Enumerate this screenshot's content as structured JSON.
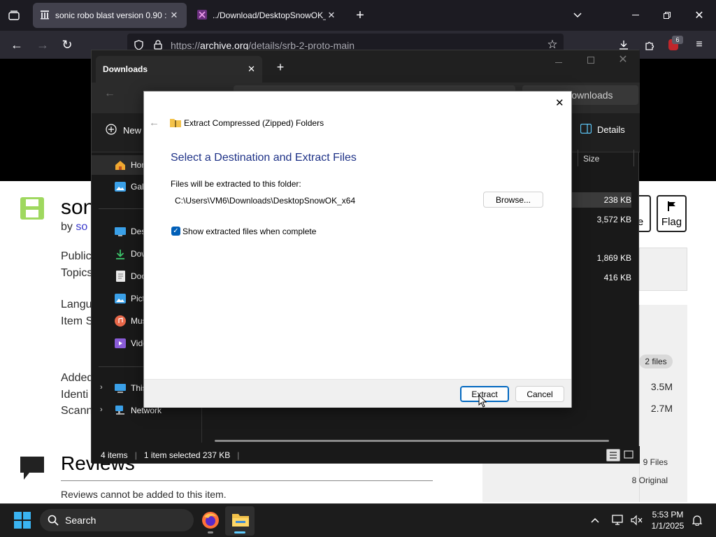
{
  "browser": {
    "tabs": [
      {
        "label": "sonic robo blast version 0.90 : s"
      },
      {
        "label": "../Download/DesktopSnowOK_"
      }
    ],
    "url_prefix": "https://",
    "url_domain": "archive.org",
    "url_path": "/details/srb-2-proto-main",
    "extensions_badge": "6"
  },
  "page": {
    "title_fragment": "son",
    "by_label": "by",
    "by_link": "so",
    "meta_lines": [
      "Public",
      "Topics",
      "Langu",
      "Item S",
      "Added",
      "Identi",
      "Scann"
    ],
    "share_label": "re",
    "flag_label": "Flag",
    "files_badge": "2 files",
    "sizes": [
      "3.5M",
      "2.7M"
    ],
    "files_count": "9 Files",
    "original_count": "8 Original",
    "reviews_heading": "Reviews",
    "reviews_note": "Reviews cannot be added to this item."
  },
  "explorer": {
    "tab_title": "Downloads",
    "search_placeholder": "Search Downloads",
    "new_label": "New",
    "details_label": "Details",
    "size_header": "Size",
    "nav_items": [
      "Hon",
      "Gall",
      "Desk",
      "Dow",
      "Doc",
      "Pict",
      "Mus",
      "Vide",
      "This",
      "Network"
    ],
    "file_sizes": [
      "238 KB",
      "3,572 KB",
      "1,869 KB",
      "416 KB"
    ],
    "status": {
      "items": "4 items",
      "selected": "1 item selected  237 KB"
    }
  },
  "dialog": {
    "window_title": "Extract Compressed (Zipped) Folders",
    "heading": "Select a Destination and Extract Files",
    "folder_label": "Files will be extracted to this folder:",
    "folder_path": "C:\\Users\\VM6\\Downloads\\DesktopSnowOK_x64",
    "browse_label": "Browse...",
    "checkbox_label": "Show extracted files when complete",
    "checkbox_checked": true,
    "extract_label": "Extract",
    "cancel_label": "Cancel"
  },
  "taskbar": {
    "search_label": "Search",
    "time": "5:53 PM",
    "date": "1/1/2025"
  },
  "colors": {
    "accent": "#005fb8",
    "dialog_heading": "#1e3287",
    "explorer_bg": "#191919",
    "browser_bg": "#1c1b22"
  }
}
